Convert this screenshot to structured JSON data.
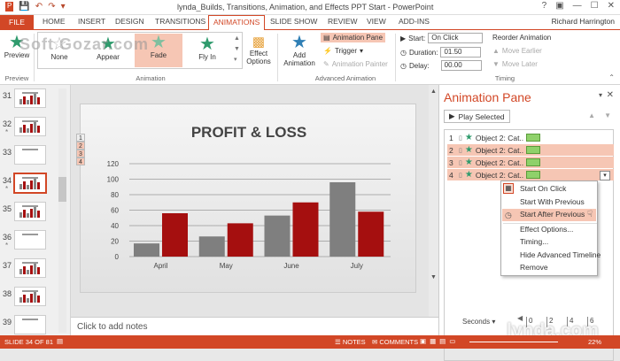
{
  "window": {
    "title": "lynda_Builds, Transitions, Animation, and Effects PPT Start - PowerPoint",
    "user": "Richard Harrington",
    "watermark": "Soft Gozar.com"
  },
  "tabs": [
    "FILE",
    "HOME",
    "INSERT",
    "DESIGN",
    "TRANSITIONS",
    "ANIMATIONS",
    "SLIDE SHOW",
    "REVIEW",
    "VIEW",
    "ADD-INS"
  ],
  "ribbon": {
    "preview": {
      "label": "Preview",
      "group": "Preview"
    },
    "animations": [
      "None",
      "Appear",
      "Fade",
      "Fly In"
    ],
    "effect_options": "Effect Options",
    "animation_group": "Animation",
    "add_animation": "Add Animation",
    "animation_pane": "Animation Pane",
    "trigger": "Trigger",
    "animation_painter": "Animation Painter",
    "advanced_group": "Advanced Animation",
    "start_label": "Start:",
    "start_value": "On Click",
    "duration_label": "Duration:",
    "duration_value": "01.50",
    "delay_label": "Delay:",
    "delay_value": "00.00",
    "reorder": "Reorder Animation",
    "move_earlier": "Move Earlier",
    "move_later": "Move Later",
    "timing_group": "Timing"
  },
  "slides": [
    {
      "num": "31",
      "mark": ""
    },
    {
      "num": "32",
      "mark": "*"
    },
    {
      "num": "33",
      "mark": ""
    },
    {
      "num": "34",
      "mark": "*"
    },
    {
      "num": "35",
      "mark": ""
    },
    {
      "num": "36",
      "mark": "*"
    },
    {
      "num": "37",
      "mark": ""
    },
    {
      "num": "38",
      "mark": ""
    },
    {
      "num": "39",
      "mark": ""
    }
  ],
  "slide_tags": [
    "1",
    "2",
    "3",
    "4"
  ],
  "chart_data": {
    "type": "bar",
    "title": "PROFIT & LOSS",
    "categories": [
      "April",
      "May",
      "June",
      "July"
    ],
    "series": [
      {
        "values": [
          17,
          26,
          53,
          96
        ],
        "color": "#7f7f7f"
      },
      {
        "values": [
          56,
          43,
          70,
          58
        ],
        "color": "#a50f0f"
      }
    ],
    "ylim": [
      0,
      120
    ],
    "yticks": [
      "0",
      "20",
      "40",
      "60",
      "80",
      "100",
      "120"
    ],
    "grid": true
  },
  "notes_placeholder": "Click to add notes",
  "pane": {
    "title": "Animation Pane",
    "play_selected": "Play Selected",
    "items": [
      {
        "num": "1",
        "label": "Object 2: Cat..."
      },
      {
        "num": "2",
        "label": "Object 2: Cat..."
      },
      {
        "num": "3",
        "label": "Object 2: Cat..."
      },
      {
        "num": "4",
        "label": "Object 2: Cat..."
      }
    ],
    "seconds_label": "Seconds",
    "timeline_ticks": [
      "0",
      "2",
      "4",
      "6"
    ]
  },
  "context_menu": [
    "Start On Click",
    "Start With Previous",
    "Start After Previous",
    "Effect Options...",
    "Timing...",
    "Hide Advanced Timeline",
    "Remove"
  ],
  "status": {
    "slide": "SLIDE 34 OF 81",
    "notes": "NOTES",
    "comments": "COMMENTS",
    "zoom": "22%"
  },
  "brand": "lynda.com",
  "colors": {
    "accent": "#d24726",
    "green": "#2f9b6d"
  }
}
